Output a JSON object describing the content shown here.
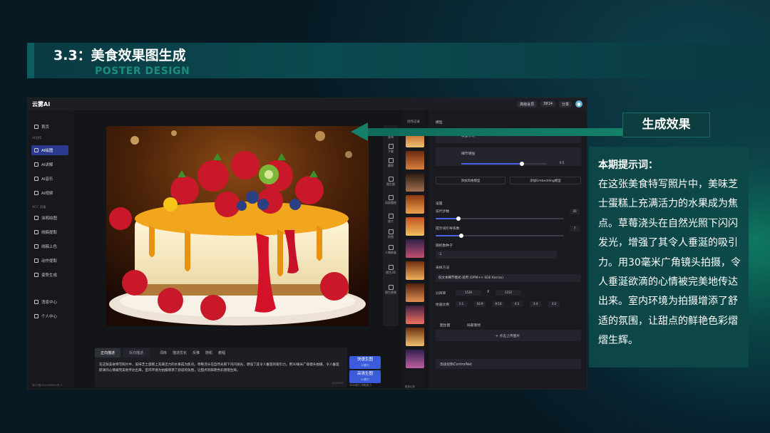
{
  "slide": {
    "title": "3.3：美食效果图生成",
    "subtitle": "POSTER DESIGN",
    "callout_label": "生成效果",
    "note_title": "本期提示词：",
    "note_body": "在这张美食特写照片中，美味芝士蛋糕上充满活力的水果成为焦点。草莓浇头在自然光照下闪闪发光，增强了其令人垂涎的吸引力。用30毫米广角镜头拍摄，令人垂涎欲滴的心情被完美地传达出来。室内环境为拍摄增添了舒适的氛围，让甜点的鲜艳色彩熠熠生辉。"
  },
  "app": {
    "logo": "云雾AI",
    "topbar": {
      "chip1": "高级会员",
      "chip2": "3814",
      "chip3": "分享"
    },
    "sidebar": {
      "home": "首页",
      "sec1": "AI创作",
      "items1": [
        "AI绘图",
        "AI讲解",
        "AI音乐",
        "AI视频"
      ],
      "sec2": "ACC 具备",
      "items2": [
        "涂鸦绘图",
        "线稿提取",
        "线稿上色",
        "动作提取",
        "姿势生成"
      ],
      "items3": [
        "消息中心",
        "个人中心"
      ],
      "footer": "粤ICP备2023000892号-3"
    },
    "tools": [
      "发布",
      "下载",
      "删除",
      "图生图",
      "局部重绘",
      "放大",
      "抠图",
      "人物修复",
      "图生3D",
      "图生视频"
    ],
    "prompt": {
      "tab1": "正向描述",
      "tab2": "反向描述",
      "tools": [
        "词库",
        "描述优化",
        "反推",
        "随机",
        "教程"
      ],
      "text": "在这张美食特写照片中，美味芝士蛋糕上充满活力的水果成为焦点。草莓浇头在自然光照下闪闪发光，增强了其令人垂涎的吸引力。用30毫米广角镜头拍摄，令人垂涎欲滴的心情被完美地传达出来。室内环境为拍摄增添了舒适的氛围，让甜点的鲜艳色彩熠熠生辉。",
      "count": "117/2000",
      "btn_fast": "快速生图",
      "btn_fast_sub": "10算力",
      "btn_hq": "高清生图",
      "btn_hq_sub": "20算力",
      "note": "3000算力 获取算力"
    },
    "panel": {
      "history": "创作记录",
      "model_h": "模型",
      "model1": "模型示例",
      "model2": "细节增强",
      "model2_val": "0.5",
      "add_style": "添加风格模型",
      "add_emb": "添加Embedding模型",
      "settings": "设置",
      "steps_l": "迭代步数",
      "steps_v": "20",
      "steps_frac": 0.18,
      "cfg_l": "提示词引导系数",
      "cfg_v": "7",
      "cfg_frac": 0.2,
      "seed_l": "随机数种子",
      "seed_v": "-1",
      "sampler_l": "采样方法",
      "sampler_v": "低文本细节模式-适用 (DPM++ SDE Karras)",
      "res_l": "分辨率",
      "w": "1536",
      "x": "X",
      "h": "1152",
      "ratio_l": "绘画比例",
      "ratios": [
        "1:1",
        "16:9",
        "9:16",
        "4:3",
        "3:4",
        "3:2"
      ],
      "img2img": "图生图",
      "ref": "局部重绘",
      "upload": "+ 点击上传图片",
      "controlnet": "高级控制ControlNet",
      "hist_note": "更多记录"
    }
  },
  "colors": {
    "accent": "#3b5bdb",
    "teal": "#14806a"
  }
}
